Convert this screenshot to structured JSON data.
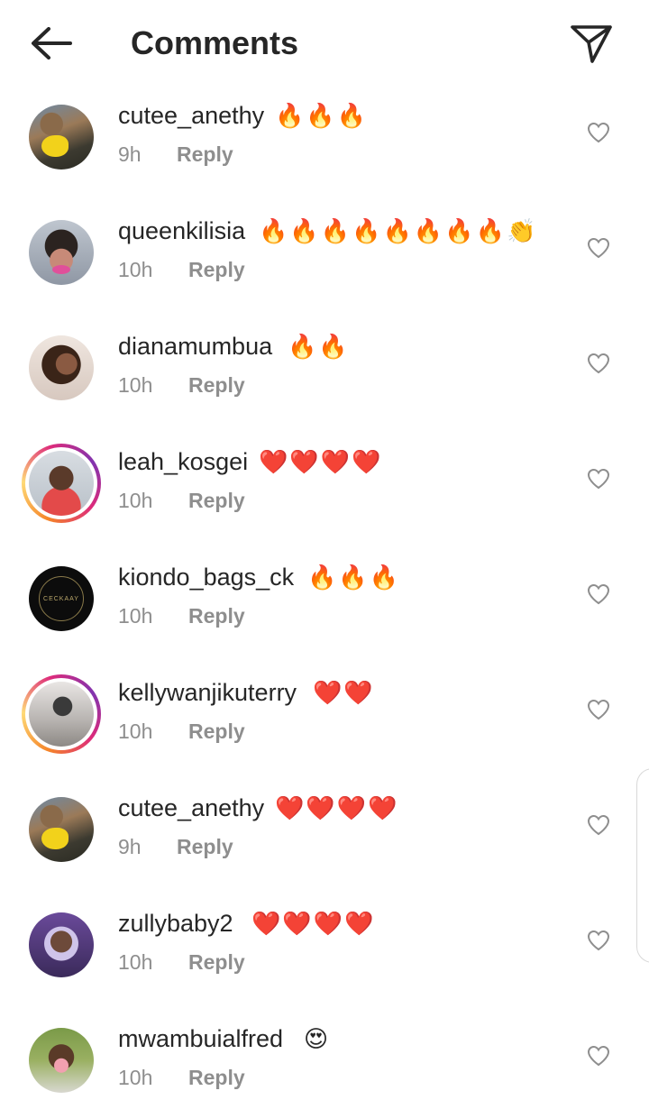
{
  "header": {
    "title": "Comments",
    "back_icon": "arrow-left-icon",
    "send_icon": "paper-plane-icon"
  },
  "comments": [
    {
      "username": "cutee_anethy",
      "emojis": "🔥🔥🔥",
      "time": "9h",
      "reply": "Reply",
      "avatar": "av-cutee",
      "story": false
    },
    {
      "username": "queenkilisia",
      "emojis": "🔥🔥🔥🔥🔥🔥🔥🔥👏",
      "time": "10h",
      "reply": "Reply",
      "avatar": "av-queen",
      "story": false
    },
    {
      "username": "dianamumbua",
      "emojis": "🔥🔥",
      "time": "10h",
      "reply": "Reply",
      "avatar": "av-diana",
      "story": false
    },
    {
      "username": "leah_kosgei",
      "emojis": "❤️❤️❤️❤️",
      "time": "10h",
      "reply": "Reply",
      "avatar": "av-leah",
      "story": true
    },
    {
      "username": "kiondo_bags_ck",
      "emojis": "🔥🔥🔥",
      "time": "10h",
      "reply": "Reply",
      "avatar": "av-kiondo",
      "story": false,
      "avatar_text": "CECKAAY"
    },
    {
      "username": "kellywanjikuterry",
      "emojis": "❤️❤️",
      "time": "10h",
      "reply": "Reply",
      "avatar": "av-kelly",
      "story": true
    },
    {
      "username": "cutee_anethy",
      "emojis": "❤️❤️❤️❤️",
      "time": "9h",
      "reply": "Reply",
      "avatar": "av-cutee",
      "story": false
    },
    {
      "username": "zullybaby2",
      "emojis": "❤️❤️❤️❤️",
      "time": "10h",
      "reply": "Reply",
      "avatar": "av-zully",
      "story": false
    },
    {
      "username": "mwambuialfred",
      "emojis": "😍",
      "time": "10h",
      "reply": "Reply",
      "avatar": "av-mwam",
      "story": false
    }
  ]
}
